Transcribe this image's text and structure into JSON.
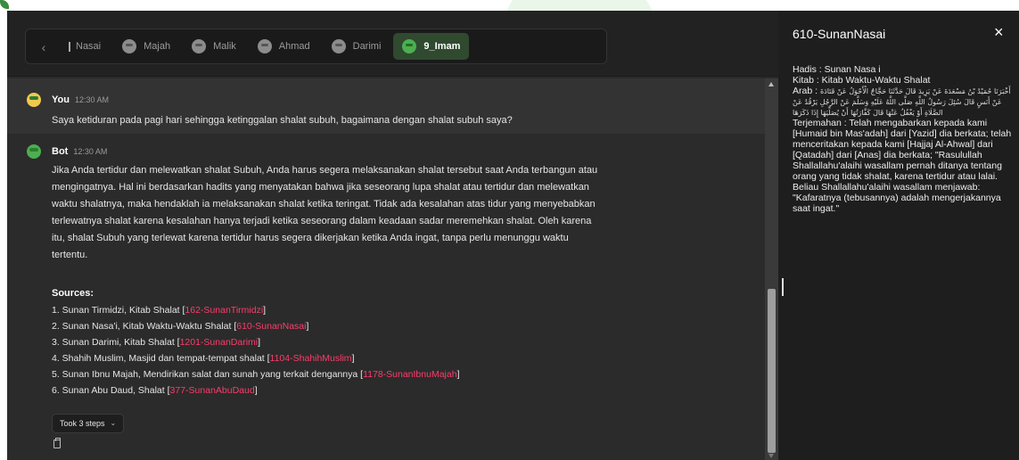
{
  "tabs": {
    "items": [
      {
        "label": "Nasai",
        "partial": true,
        "active": false
      },
      {
        "label": "Majah",
        "active": false
      },
      {
        "label": "Malik",
        "active": false
      },
      {
        "label": "Ahmad",
        "active": false
      },
      {
        "label": "Darimi",
        "active": false
      },
      {
        "label": "9_Imam",
        "active": true
      }
    ]
  },
  "user_message": {
    "sender": "You",
    "time": "12:30 AM",
    "text": "Saya ketiduran pada pagi hari sehingga ketinggalan shalat subuh, bagaimana dengan shalat subuh saya?"
  },
  "bot_message": {
    "sender": "Bot",
    "time": "12:30 AM",
    "text": "Jika Anda tertidur dan melewatkan shalat Subuh, Anda harus segera melaksanakan shalat tersebut saat Anda terbangun atau mengingatnya. Hal ini berdasarkan hadits yang menyatakan bahwa jika seseorang lupa shalat atau tertidur dan melewatkan waktu shalatnya, maka hendaklah ia melaksanakan shalat ketika teringat. Tidak ada kesalahan atas tidur yang menyebabkan terlewatnya shalat karena kesalahan hanya terjadi ketika seseorang dalam keadaan sadar meremehkan shalat. Oleh karena itu, shalat Subuh yang terlewat karena tertidur harus segera dikerjakan ketika Anda ingat, tanpa perlu menunggu waktu tertentu.",
    "sources_title": "Sources:",
    "sources": [
      {
        "text": "1. Sunan Tirmidzi, Kitab Shalat [",
        "ref": "162-SunanTirmidzi",
        "close": "]"
      },
      {
        "text": "2. Sunan Nasa'i, Kitab Waktu-Waktu Shalat [",
        "ref": "610-SunanNasai",
        "close": "]"
      },
      {
        "text": "3. Sunan Darimi, Kitab Shalat [",
        "ref": "1201-SunanDarimi",
        "close": "]"
      },
      {
        "text": "4. Shahih Muslim, Masjid dan tempat-tempat shalat [",
        "ref": "1104-ShahihMuslim",
        "close": "]"
      },
      {
        "text": "5. Sunan Ibnu Majah, Mendirikan salat dan sunah yang terkait dengannya [",
        "ref": "1178-SunanIbnuMajah",
        "close": "]"
      },
      {
        "text": "6. Sunan Abu Daud, Shalat [",
        "ref": "377-SunanAbuDaud",
        "close": "]"
      }
    ],
    "steps_label": "Took 3 steps"
  },
  "panel": {
    "title": "610-SunanNasai",
    "close": "×",
    "hadis": "Hadis : Sunan Nasa i",
    "kitab": "Kitab : Kitab Waktu-Waktu Shalat",
    "arab_label": "Arab :",
    "arab_text": "أَخْبَرَنَا حُمَيْدُ بْنُ مَسْعَدَةَ عَنْ يَزِيدَ قَالَ حَدَّثَنَا حَجَّاجٌ الْأَحْوَلُ عَنْ قَتَادَةَ عَنْ أَنَسٍ قَالَ سُئِلَ رَسُولُ اللَّهِ صَلَّى اللَّهُ عَلَيْهِ وَسَلَّمَ عَنْ الرَّجُلِ يَرْقُدُ عَنْ الصَّلَاةِ أَوْ يَغْفُلُ عَنْهَا قَالَ كَفَّارَتُهَا أَنْ يُصَلِّيَهَا إِذَا ذَكَرَهَا",
    "terjemahan": "Terjemahan : Telah mengabarkan kepada kami [Humaid bin Mas'adah] dari [Yazid] dia berkata; telah menceritakan kepada kami [Hajjaj Al-Ahwal] dari [Qatadah] dari [Anas] dia berkata; \"Rasulullah Shallallahu'alaihi wasallam pernah ditanya tentang orang yang tidak shalat, karena tertidur atau lalai. Beliau Shallallahu'alaihi wasallam menjawab: \"Kafaratnya (tebusannya) adalah mengerjakannya saat ingat.\""
  }
}
